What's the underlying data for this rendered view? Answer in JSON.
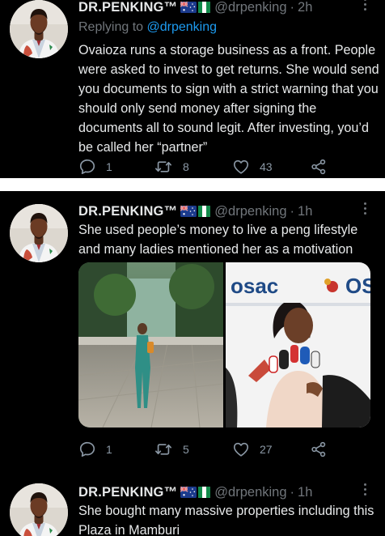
{
  "tweets": [
    {
      "name": "DR.PENKING™",
      "handle": "@drpenking",
      "time": "2h",
      "reply_prefix": "Replying to ",
      "reply_to": "@drpenking",
      "text": "Ovaioza runs a storage business as a front. People were asked to invest to get returns. She would send you documents to sign with a strict warning that you should only send money after signing the documents all to sound legit. After investing, you’d be called her “partner”",
      "replies": "1",
      "retweets": "8",
      "likes": "43"
    },
    {
      "name": "DR.PENKING™",
      "handle": "@drpenking",
      "time": "1h",
      "text": "She used people’s money to live a peng lifestyle and many ladies mentioned her as a motivation",
      "media_right_signage": [
        "osac",
        "OS"
      ],
      "replies": "1",
      "retweets": "5",
      "likes": "27"
    },
    {
      "name": "DR.PENKING™",
      "handle": "@drpenking",
      "time": "1h",
      "text": "She bought many massive properties including this Plaza in Mamburi"
    }
  ],
  "colors": {
    "background": "#000000",
    "text": "#e7e9ea",
    "muted": "#71767b",
    "link": "#1d9bf0",
    "separator": "#ffffff"
  },
  "icons": [
    "reply-icon",
    "retweet-icon",
    "like-icon",
    "share-icon",
    "australia-flag-icon",
    "nigeria-flag-icon",
    "more-icon"
  ]
}
